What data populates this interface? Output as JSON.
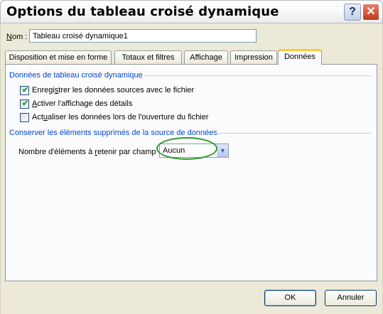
{
  "window": {
    "title": "Options du tableau croisé dynamique",
    "help_glyph": "?",
    "close_glyph": "✕"
  },
  "name": {
    "label_mnemonic": "N",
    "label_rest": "om :",
    "value": "Tableau croisé dynamique1"
  },
  "tabs": [
    {
      "label": "Disposition et mise en forme",
      "active": false
    },
    {
      "label": "Totaux et filtres",
      "active": false
    },
    {
      "label": "Affichage",
      "active": false
    },
    {
      "label": "Impression",
      "active": false
    },
    {
      "label": "Données",
      "active": true
    }
  ],
  "section1": {
    "title": "Données de tableau croisé dynamique",
    "checkboxes": [
      {
        "pre": "Enregi",
        "mn": "s",
        "post": "trer les données sources avec le fichier",
        "checked": true
      },
      {
        "pre": "",
        "mn": "A",
        "post": "ctiver l'affichage des détails",
        "checked": true
      },
      {
        "pre": "Act",
        "mn": "u",
        "post": "aliser les données lors de l'ouverture du fichier",
        "checked": false
      }
    ]
  },
  "section2": {
    "title": "Conserver les éléments supprimés de la source de données",
    "field_label_pre": "Nombre d'éléments à ",
    "field_label_mn": "r",
    "field_label_post": "etenir par champ",
    "field_value": "Aucun"
  },
  "buttons": {
    "ok": "OK",
    "cancel": "Annuler"
  },
  "colors": {
    "group_title": "#0046d5",
    "active_tab_accent": "#ffc83c",
    "highlight_ellipse": "#2e9a2e"
  }
}
